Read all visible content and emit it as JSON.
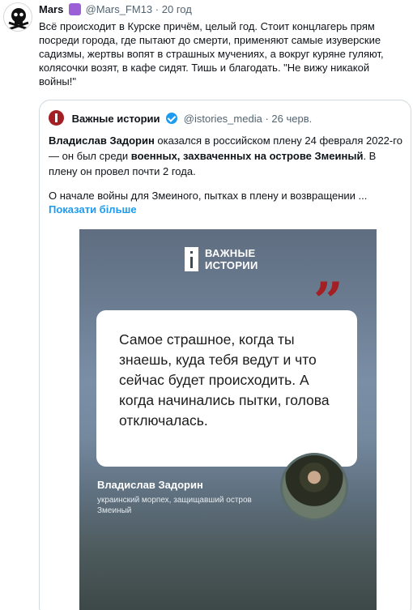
{
  "tweet": {
    "author_name": "Mars",
    "handle": "@Mars_FM13",
    "separator": "·",
    "time": "20 год",
    "text": "Всё происходит в Курске причём, целый год. Стоит концлагерь прям посреди города, где пытают до смерти, применяют самые изуверские садизмы, жертвы вопят в страшных мучениях, а вокруг куряне гуляют, колясочки возят, в кафе сидят. Тишь и благодать. \"Не вижу никакой войны!\""
  },
  "quoted": {
    "author_name": "Важные истории",
    "handle": "@istories_media",
    "separator": "·",
    "time": "26 черв.",
    "text_parts": {
      "p1": "Владислав Задорин",
      "p2": " оказался в российском плену 24 февраля 2022-го — он был среди ",
      "p3": "военных, захваченных на острове Змеиный",
      "p4": ". В плену он провел почти 2 года."
    },
    "line2": "О начале войны для Змеиного, пытках в плену и возвращении ...",
    "show_more": "Показати більше"
  },
  "card": {
    "logo_line1": "ВАЖНЫЕ",
    "logo_line2": "ИСТОРИИ",
    "quote_marks": "”",
    "quote_text": "Самое страшное, когда ты знаешь, куда тебя ведут и что сейчас будет происходить. А когда начинались пытки, голова отключалась.",
    "speaker_name": "Владислав Задорин",
    "speaker_role": "украинский морпех, защищавший остров Змеиный"
  },
  "icons": {
    "avatar": "skull-crossbones-icon",
    "badge": "badge-icon",
    "verified": "verified-check-icon"
  },
  "colors": {
    "link": "#1d9bf0",
    "accent": "#a31f24",
    "badge": "#9b5fd6"
  }
}
